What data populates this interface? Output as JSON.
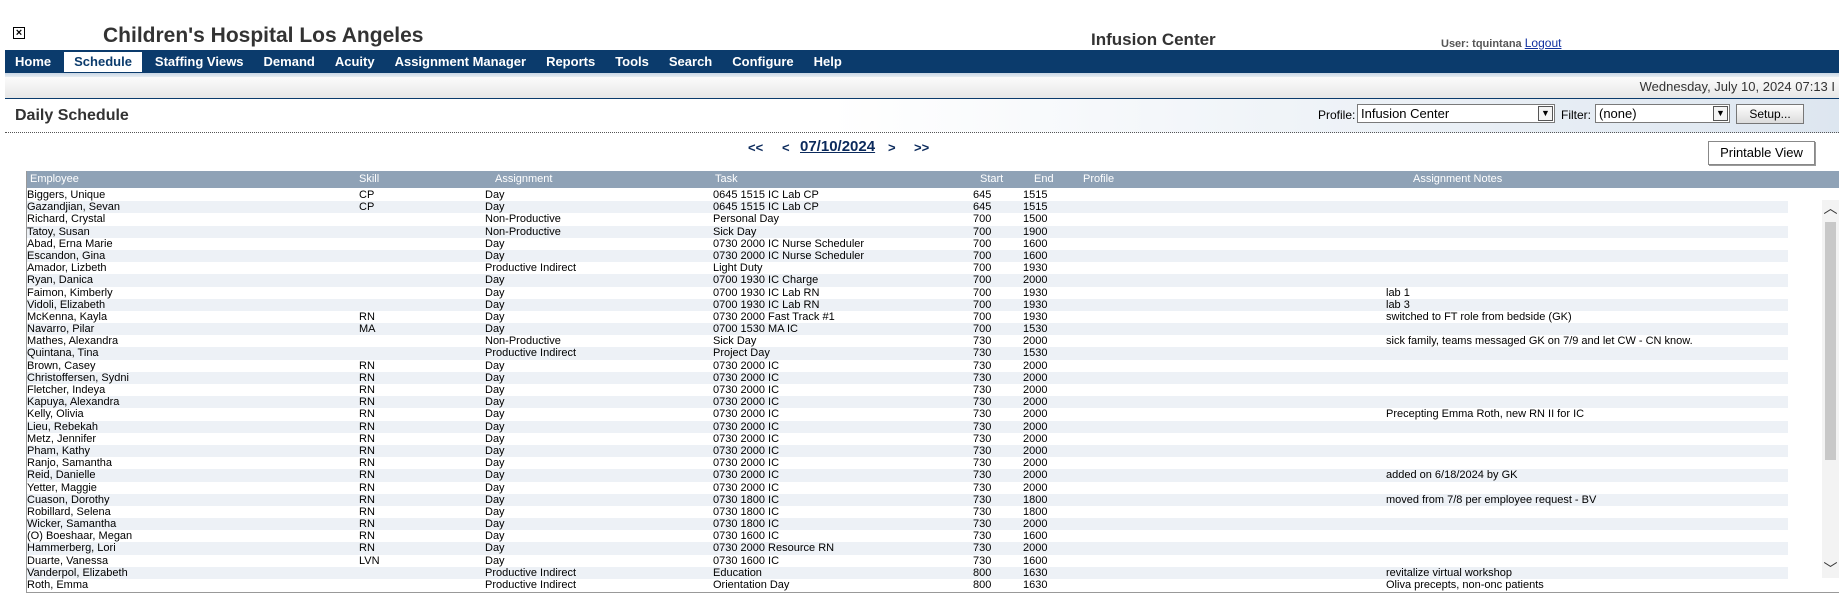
{
  "header": {
    "org_name": "Children's Hospital Los Angeles",
    "unit_name": "Infusion Center",
    "user_label": "User: tquintana",
    "logout_label": "Logout"
  },
  "menu": [
    "Home",
    "Schedule",
    "Staffing Views",
    "Demand",
    "Acuity",
    "Assignment Manager",
    "Reports",
    "Tools",
    "Search",
    "Configure",
    "Help"
  ],
  "menu_active": "Schedule",
  "datetime": "Wednesday, July 10, 2024 07:13 I",
  "page": {
    "title": "Daily Schedule",
    "profile_label": "Profile:",
    "profile_value": "Infusion Center",
    "filter_label": "Filter:",
    "filter_value": "(none)",
    "setup_label": "Setup...",
    "printable_label": "Printable View"
  },
  "nav": {
    "first": "<<",
    "prev": "<",
    "date": "07/10/2024",
    "next": ">",
    "last": ">>"
  },
  "columns": {
    "employee": "Employee",
    "skill": "Skill",
    "assignment": "Assignment",
    "task": "Task",
    "start": "Start",
    "end": "End",
    "profile": "Profile",
    "notes": "Assignment Notes"
  },
  "rows": [
    [
      "Biggers, Unique",
      "CP",
      "Day",
      "0645 1515 IC Lab CP",
      "645",
      "1515",
      ""
    ],
    [
      "Gazandjian, Sevan",
      "CP",
      "Day",
      "0645 1515 IC Lab CP",
      "645",
      "1515",
      ""
    ],
    [
      "Richard, Crystal",
      "",
      "Non-Productive",
      "Personal Day",
      "700",
      "1500",
      ""
    ],
    [
      "Tatoy, Susan",
      "",
      "Non-Productive",
      "Sick Day",
      "700",
      "1900",
      ""
    ],
    [
      "Abad, Erna Marie",
      "",
      "Day",
      "0730 2000 IC Nurse Scheduler",
      "700",
      "1600",
      ""
    ],
    [
      "Escandon, Gina",
      "",
      "Day",
      "0730 2000 IC Nurse Scheduler",
      "700",
      "1600",
      ""
    ],
    [
      "Amador, Lizbeth",
      "",
      "Productive Indirect",
      "Light Duty",
      "700",
      "1930",
      ""
    ],
    [
      "Ryan, Danica",
      "",
      "Day",
      "0700 1930 IC Charge",
      "700",
      "2000",
      ""
    ],
    [
      "Faimon, Kimberly",
      "",
      "Day",
      "0700 1930 IC Lab RN",
      "700",
      "1930",
      "lab 1"
    ],
    [
      "Vidoli, Elizabeth",
      "",
      "Day",
      "0700 1930 IC Lab RN",
      "700",
      "1930",
      "lab 3"
    ],
    [
      "McKenna, Kayla",
      "RN",
      "Day",
      "0730 2000 Fast Track #1",
      "700",
      "1930",
      "switched to FT role from bedside (GK)"
    ],
    [
      "Navarro, Pilar",
      "MA",
      "Day",
      "0700 1530 MA IC",
      "700",
      "1530",
      ""
    ],
    [
      "Mathes, Alexandra",
      "",
      "Non-Productive",
      "Sick Day",
      "730",
      "2000",
      "sick family, teams messaged GK on 7/9 and let CW - CN know."
    ],
    [
      "Quintana, Tina",
      "",
      "Productive Indirect",
      "Project Day",
      "730",
      "1530",
      ""
    ],
    [
      "Brown, Casey",
      "RN",
      "Day",
      "0730 2000 IC",
      "730",
      "2000",
      ""
    ],
    [
      "Christoffersen, Sydni",
      "RN",
      "Day",
      "0730 2000 IC",
      "730",
      "2000",
      ""
    ],
    [
      "Fletcher, Indeya",
      "RN",
      "Day",
      "0730 2000 IC",
      "730",
      "2000",
      ""
    ],
    [
      "Kapuya, Alexandra",
      "RN",
      "Day",
      "0730 2000 IC",
      "730",
      "2000",
      ""
    ],
    [
      "Kelly, Olivia",
      "RN",
      "Day",
      "0730 2000 IC",
      "730",
      "2000",
      "Precepting Emma Roth, new RN II for IC"
    ],
    [
      "Lieu, Rebekah",
      "RN",
      "Day",
      "0730 2000 IC",
      "730",
      "2000",
      ""
    ],
    [
      "Metz, Jennifer",
      "RN",
      "Day",
      "0730 2000 IC",
      "730",
      "2000",
      ""
    ],
    [
      "Pham, Kathy",
      "RN",
      "Day",
      "0730 2000 IC",
      "730",
      "2000",
      ""
    ],
    [
      "Ranjo, Samantha",
      "RN",
      "Day",
      "0730 2000 IC",
      "730",
      "2000",
      ""
    ],
    [
      "Reid, Danielle",
      "RN",
      "Day",
      "0730 2000 IC",
      "730",
      "2000",
      "added on 6/18/2024 by GK"
    ],
    [
      "Yetter, Maggie",
      "RN",
      "Day",
      "0730 2000 IC",
      "730",
      "2000",
      ""
    ],
    [
      "Cuason, Dorothy",
      "RN",
      "Day",
      "0730 1800 IC",
      "730",
      "1800",
      "moved from 7/8 per employee request - BV"
    ],
    [
      "Robillard, Selena",
      "RN",
      "Day",
      "0730 1800 IC",
      "730",
      "1800",
      ""
    ],
    [
      "Wicker, Samantha",
      "RN",
      "Day",
      "0730 1800 IC",
      "730",
      "2000",
      ""
    ],
    [
      "(O) Boeshaar, Megan",
      "RN",
      "Day",
      "0730 1600 IC",
      "730",
      "1600",
      ""
    ],
    [
      "Hammerberg, Lori",
      "RN",
      "Day",
      "0730 2000 Resource RN",
      "730",
      "2000",
      ""
    ],
    [
      "Duarte, Vanessa",
      "LVN",
      "Day",
      "0730 1600 IC",
      "730",
      "1600",
      ""
    ],
    [
      "Vanderpol, Elizabeth",
      "",
      "Productive Indirect",
      "Education",
      "800",
      "1630",
      "revitalize virtual workshop"
    ],
    [
      "Roth, Emma",
      "",
      "Productive Indirect",
      "Orientation Day",
      "800",
      "1630",
      "Oliva precepts, non-onc patients"
    ]
  ]
}
